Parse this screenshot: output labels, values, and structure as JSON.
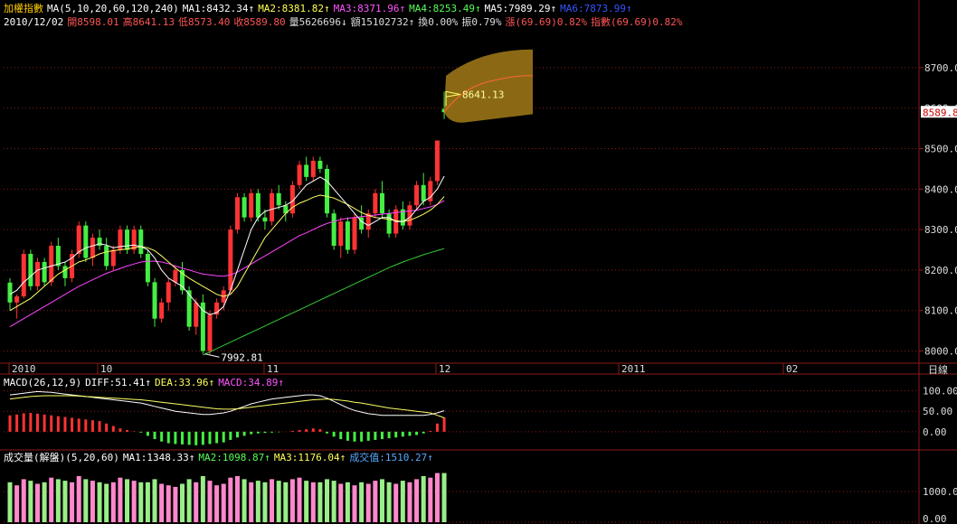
{
  "header": {
    "index_name": "加權指數",
    "ma_params": "MA(5,10,20,60,120,240)",
    "ma_values": [
      {
        "label": "MA1:8432.34↑",
        "color": "#ffffff"
      },
      {
        "label": "MA2:8381.82↑",
        "color": "#ffff55"
      },
      {
        "label": "MA3:8371.96↑",
        "color": "#ff55ff"
      },
      {
        "label": "MA4:8253.49↑",
        "color": "#55ff55"
      },
      {
        "label": "MA5:7989.29↑",
        "color": "#ffffff"
      },
      {
        "label": "MA6:7873.99↑",
        "color": "#3355ff"
      }
    ],
    "date": "2010/12/02",
    "quote": [
      {
        "label": "開8598.01",
        "color": "#ff5555"
      },
      {
        "label": "高8641.13",
        "color": "#ff5555"
      },
      {
        "label": "低8573.40",
        "color": "#ff5555"
      },
      {
        "label": "收8589.80",
        "color": "#ff5555"
      },
      {
        "label": "量5626696↓",
        "color": "#dddddd"
      },
      {
        "label": "額15102732↑",
        "color": "#dddddd"
      },
      {
        "label": "換0.00%",
        "color": "#dddddd"
      },
      {
        "label": "振0.79%",
        "color": "#dddddd"
      },
      {
        "label": "漲(69.69)0.82%",
        "color": "#ff5555"
      },
      {
        "label": "指數(69.69)0.82%",
        "color": "#ff5555"
      }
    ]
  },
  "price_axis": {
    "ticks": [
      "8700.00",
      "8600.00",
      "8500.00",
      "8400.00",
      "8300.00",
      "8200.00",
      "8100.00",
      "8000.00"
    ],
    "current": "8589.8"
  },
  "annotations": {
    "low_label": "7992.81",
    "high_label": "8641.13"
  },
  "time_axis": {
    "labels": [
      "2010",
      "10",
      "11",
      "12",
      "2011",
      "02"
    ],
    "period": "日線"
  },
  "macd": {
    "params": "MACD(26,12,9)",
    "diff": "DIFF:51.41↑",
    "dea": "DEA:33.96↑",
    "macd": "MACD:34.89↑",
    "ticks": [
      "100.00",
      "50.00",
      "0.00"
    ]
  },
  "volume": {
    "params": "成交量(解盤)(5,20,60)",
    "ma1": "MA1:1348.33↑",
    "ma2": "MA2:1098.87↑",
    "ma3": "MA3:1176.04↑",
    "amount": "成交值:1510.27↑",
    "ticks": [
      "1000.00",
      "0.00"
    ]
  },
  "colors": {
    "up": "#ff3333",
    "down": "#44ee44",
    "grid": "#8b1a1a",
    "axis_text": "#dddddd",
    "ma_white": "#ffffff",
    "ma_yellow": "#ffff66",
    "ma_magenta": "#ff44ff",
    "ma_green": "#33cc33",
    "forecast": "#8b6914"
  },
  "chart_data": {
    "type": "candlestick",
    "candles": [
      [
        8169,
        8180,
        8100,
        8120
      ],
      [
        8120,
        8140,
        8080,
        8135
      ],
      [
        8135,
        8250,
        8130,
        8240
      ],
      [
        8240,
        8250,
        8150,
        8160
      ],
      [
        8160,
        8230,
        8150,
        8220
      ],
      [
        8220,
        8230,
        8160,
        8170
      ],
      [
        8170,
        8270,
        8160,
        8260
      ],
      [
        8260,
        8280,
        8200,
        8210
      ],
      [
        8210,
        8220,
        8160,
        8180
      ],
      [
        8180,
        8250,
        8170,
        8240
      ],
      [
        8240,
        8320,
        8230,
        8310
      ],
      [
        8310,
        8320,
        8220,
        8230
      ],
      [
        8230,
        8290,
        8210,
        8280
      ],
      [
        8280,
        8300,
        8250,
        8260
      ],
      [
        8260,
        8280,
        8200,
        8210
      ],
      [
        8210,
        8260,
        8200,
        8250
      ],
      [
        8250,
        8310,
        8240,
        8300
      ],
      [
        8300,
        8310,
        8240,
        8250
      ],
      [
        8250,
        8310,
        8240,
        8300
      ],
      [
        8300,
        8310,
        8230,
        8240
      ],
      [
        8240,
        8250,
        8160,
        8170
      ],
      [
        8170,
        8180,
        8060,
        8080
      ],
      [
        8080,
        8130,
        8070,
        8120
      ],
      [
        8120,
        8180,
        8100,
        8170
      ],
      [
        8170,
        8210,
        8160,
        8200
      ],
      [
        8200,
        8220,
        8140,
        8150
      ],
      [
        8150,
        8160,
        8050,
        8060
      ],
      [
        8060,
        8130,
        8040,
        8120
      ],
      [
        8120,
        8140,
        7993,
        8000
      ],
      [
        8000,
        8100,
        7990,
        8090
      ],
      [
        8090,
        8130,
        8080,
        8120
      ],
      [
        8120,
        8160,
        8100,
        8150
      ],
      [
        8150,
        8310,
        8140,
        8300
      ],
      [
        8300,
        8390,
        8290,
        8380
      ],
      [
        8380,
        8390,
        8320,
        8330
      ],
      [
        8330,
        8400,
        8320,
        8390
      ],
      [
        8390,
        8400,
        8320,
        8330
      ],
      [
        8330,
        8350,
        8300,
        8320
      ],
      [
        8320,
        8400,
        8310,
        8390
      ],
      [
        8390,
        8410,
        8350,
        8360
      ],
      [
        8360,
        8370,
        8320,
        8340
      ],
      [
        8340,
        8420,
        8330,
        8410
      ],
      [
        8410,
        8470,
        8400,
        8460
      ],
      [
        8460,
        8480,
        8420,
        8430
      ],
      [
        8430,
        8480,
        8420,
        8470
      ],
      [
        8470,
        8480,
        8440,
        8450
      ],
      [
        8450,
        8460,
        8330,
        8340
      ],
      [
        8340,
        8350,
        8250,
        8260
      ],
      [
        8260,
        8330,
        8230,
        8320
      ],
      [
        8320,
        8330,
        8240,
        8250
      ],
      [
        8250,
        8340,
        8240,
        8330
      ],
      [
        8330,
        8360,
        8290,
        8300
      ],
      [
        8300,
        8350,
        8280,
        8340
      ],
      [
        8340,
        8400,
        8330,
        8390
      ],
      [
        8390,
        8420,
        8330,
        8340
      ],
      [
        8340,
        8350,
        8280,
        8290
      ],
      [
        8290,
        8360,
        8280,
        8350
      ],
      [
        8350,
        8370,
        8300,
        8310
      ],
      [
        8310,
        8370,
        8300,
        8360
      ],
      [
        8360,
        8420,
        8350,
        8410
      ],
      [
        8410,
        8440,
        8360,
        8370
      ],
      [
        8370,
        8430,
        8360,
        8420
      ],
      [
        8420,
        8520,
        8410,
        8520
      ],
      [
        8598,
        8641,
        8573,
        8590
      ]
    ],
    "ma5": [
      8140,
      8150,
      8170,
      8185,
      8200,
      8205,
      8210,
      8215,
      8220,
      8230,
      8245,
      8255,
      8260,
      8265,
      8262,
      8255,
      8258,
      8260,
      8262,
      8258,
      8250,
      8230,
      8200,
      8180,
      8170,
      8160,
      8140,
      8120,
      8100,
      8090,
      8095,
      8110,
      8150,
      8200,
      8250,
      8300,
      8330,
      8345,
      8350,
      8355,
      8360,
      8370,
      8390,
      8410,
      8420,
      8430,
      8420,
      8400,
      8380,
      8360,
      8340,
      8320,
      8310,
      8320,
      8330,
      8330,
      8320,
      8320,
      8330,
      8350,
      8370,
      8380,
      8400,
      8432
    ],
    "ma10": [
      8100,
      8110,
      8120,
      8130,
      8145,
      8160,
      8175,
      8190,
      8200,
      8210,
      8220,
      8225,
      8232,
      8240,
      8245,
      8248,
      8250,
      8252,
      8255,
      8258,
      8255,
      8248,
      8235,
      8220,
      8205,
      8192,
      8180,
      8170,
      8160,
      8150,
      8140,
      8135,
      8140,
      8160,
      8190,
      8220,
      8250,
      8280,
      8300,
      8320,
      8340,
      8355,
      8365,
      8372,
      8380,
      8385,
      8382,
      8378,
      8370,
      8362,
      8352,
      8342,
      8335,
      8330,
      8328,
      8325,
      8322,
      8320,
      8323,
      8330,
      8338,
      8348,
      8362,
      8382
    ],
    "ma20": [
      8060,
      8070,
      8080,
      8090,
      8100,
      8110,
      8120,
      8130,
      8140,
      8150,
      8160,
      8168,
      8176,
      8184,
      8192,
      8198,
      8204,
      8210,
      8215,
      8220,
      8222,
      8222,
      8220,
      8216,
      8210,
      8205,
      8200,
      8195,
      8190,
      8188,
      8186,
      8185,
      8188,
      8195,
      8205,
      8215,
      8225,
      8235,
      8245,
      8255,
      8265,
      8275,
      8285,
      8292,
      8300,
      8308,
      8315,
      8320,
      8325,
      8328,
      8330,
      8332,
      8334,
      8336,
      8338,
      8340,
      8342,
      8344,
      8346,
      8348,
      8352,
      8356,
      8362,
      8372
    ],
    "ma60": [
      null,
      null,
      null,
      null,
      null,
      null,
      null,
      null,
      null,
      null,
      null,
      null,
      null,
      null,
      null,
      null,
      null,
      null,
      null,
      null,
      null,
      null,
      null,
      null,
      null,
      null,
      null,
      null,
      7990,
      7998,
      8006,
      8014,
      8022,
      8030,
      8038,
      8046,
      8054,
      8062,
      8070,
      8078,
      8086,
      8094,
      8102,
      8110,
      8118,
      8126,
      8134,
      8142,
      8150,
      8158,
      8166,
      8174,
      8182,
      8190,
      8198,
      8206,
      8213,
      8220,
      8226,
      8232,
      8238,
      8243,
      8248,
      8253
    ],
    "macd_bars": [
      40,
      42,
      45,
      46,
      44,
      42,
      40,
      38,
      36,
      34,
      32,
      30,
      28,
      26,
      20,
      14,
      8,
      4,
      1,
      -2,
      -10,
      -18,
      -24,
      -28,
      -30,
      -31,
      -32,
      -33,
      -32,
      -30,
      -28,
      -26,
      -20,
      -14,
      -10,
      -6,
      -4,
      -3,
      -2,
      -1,
      0,
      2,
      4,
      6,
      8,
      6,
      -4,
      -12,
      -18,
      -22,
      -24,
      -24,
      -22,
      -20,
      -18,
      -16,
      -14,
      -12,
      -10,
      -8,
      -4,
      2,
      20,
      34.89
    ],
    "macd_diff": [
      90,
      92,
      94,
      96,
      98,
      97,
      96,
      94,
      92,
      90,
      88,
      86,
      84,
      82,
      80,
      78,
      76,
      74,
      72,
      70,
      66,
      62,
      58,
      54,
      50,
      48,
      46,
      44,
      42,
      42,
      44,
      46,
      50,
      56,
      62,
      68,
      72,
      76,
      80,
      82,
      84,
      86,
      88,
      90,
      90,
      88,
      82,
      74,
      66,
      58,
      52,
      48,
      44,
      42,
      40,
      40,
      40,
      40,
      40,
      40,
      40,
      42,
      46,
      51.41
    ],
    "macd_dea": [
      80,
      82,
      84,
      86,
      87,
      88,
      88,
      88,
      88,
      88,
      87,
      86,
      85,
      84,
      83,
      82,
      81,
      80,
      79,
      78,
      76,
      74,
      72,
      70,
      68,
      66,
      64,
      62,
      60,
      58,
      56,
      55,
      55,
      56,
      58,
      60,
      62,
      64,
      66,
      68,
      70,
      72,
      74,
      76,
      78,
      79,
      80,
      79,
      77,
      75,
      72,
      70,
      67,
      64,
      61,
      58,
      56,
      54,
      52,
      50,
      48,
      46,
      40,
      33.96
    ],
    "volume": [
      1300,
      1200,
      1400,
      1350,
      1250,
      1300,
      1450,
      1400,
      1350,
      1300,
      1500,
      1400,
      1350,
      1300,
      1250,
      1300,
      1450,
      1400,
      1350,
      1300,
      1300,
      1400,
      1250,
      1200,
      1150,
      1250,
      1400,
      1300,
      1500,
      1350,
      1200,
      1250,
      1450,
      1500,
      1400,
      1300,
      1350,
      1300,
      1400,
      1350,
      1300,
      1400,
      1450,
      1350,
      1300,
      1300,
      1400,
      1350,
      1250,
      1300,
      1200,
      1300,
      1250,
      1350,
      1400,
      1300,
      1250,
      1350,
      1300,
      1400,
      1500,
      1450,
      1600,
      1600
    ]
  }
}
